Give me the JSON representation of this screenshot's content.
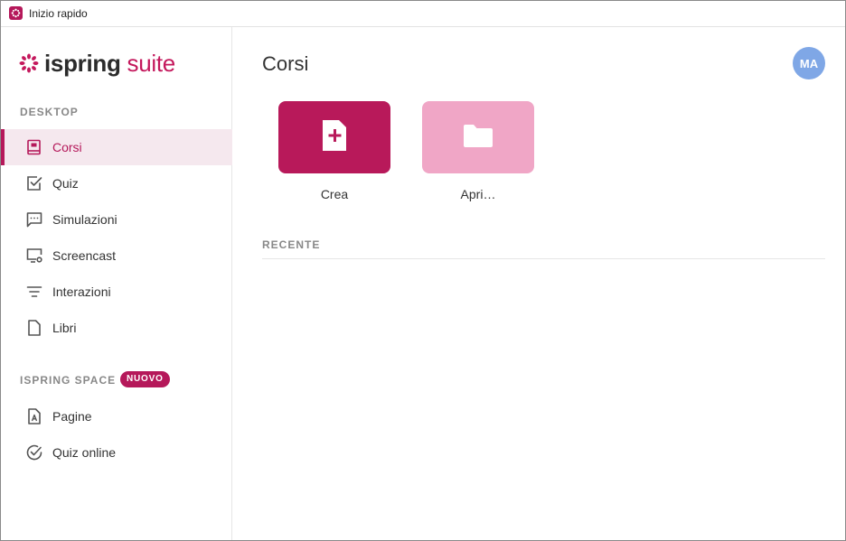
{
  "window": {
    "title": "Inizio rapido"
  },
  "logo": {
    "ispring": "ispring",
    "suite": "suite",
    "brand_color": "#c4185c"
  },
  "sidebar": {
    "desktop_label": "DESKTOP",
    "desktop_items": [
      {
        "label": "Corsi",
        "icon": "book-icon",
        "active": true
      },
      {
        "label": "Quiz",
        "icon": "checkbox-icon"
      },
      {
        "label": "Simulazioni",
        "icon": "chat-bubble-icon"
      },
      {
        "label": "Screencast",
        "icon": "monitor-record-icon"
      },
      {
        "label": "Interazioni",
        "icon": "lines-icon"
      },
      {
        "label": "Libri",
        "icon": "document-icon"
      }
    ],
    "space_label": "ISPRING SPACE",
    "space_badge": "NUOVO",
    "space_items": [
      {
        "label": "Pagine",
        "icon": "page-a-icon"
      },
      {
        "label": "Quiz online",
        "icon": "check-circle-icon"
      }
    ]
  },
  "main": {
    "title": "Corsi",
    "avatar_initials": "MA",
    "tiles": [
      {
        "label": "Crea",
        "icon": "new-file-icon",
        "color": "#b8195a"
      },
      {
        "label": "Apri…",
        "icon": "folder-icon",
        "color": "#f0a6c6"
      }
    ],
    "recent_label": "RECENTE"
  },
  "colors": {
    "accent": "#b5185a",
    "active_bg": "#f5e8ee",
    "avatar_bg": "#7fa7e6"
  }
}
